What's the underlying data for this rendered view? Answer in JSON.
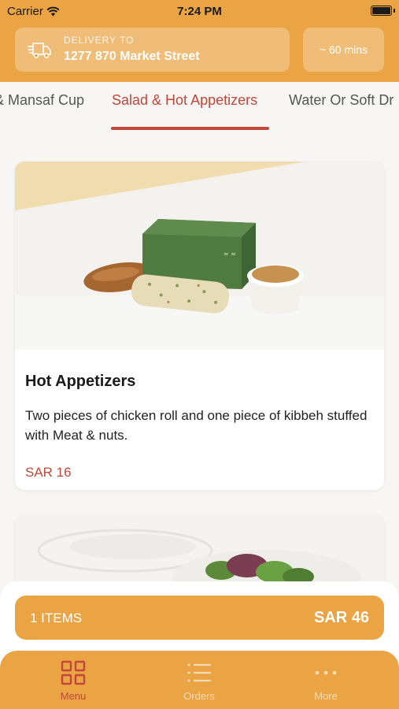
{
  "status_bar": {
    "carrier": "Carrier",
    "time": "7:24 PM"
  },
  "delivery": {
    "label": "DELIVERY TO",
    "address": "1277 870 Market Street",
    "eta": "~ 60 mins"
  },
  "tabs": [
    {
      "label": "& Mansaf Cup"
    },
    {
      "label": "Salad & Hot Appetizers",
      "active": true
    },
    {
      "label": "Water Or Soft Dr"
    }
  ],
  "products": [
    {
      "title": "Hot Appetizers",
      "description": "Two pieces of chicken roll and one  piece of kibbeh stuffed with Meat & nuts.",
      "price": "SAR 16"
    }
  ],
  "cart": {
    "items": "1 ITEMS",
    "total": "SAR 46"
  },
  "nav": [
    {
      "label": "Menu",
      "icon": "grid-icon",
      "active": true
    },
    {
      "label": "Orders",
      "icon": "list-icon"
    },
    {
      "label": "More",
      "icon": "more-icon"
    }
  ],
  "colors": {
    "brand": "#eba444",
    "accent": "#c0473a",
    "background": "#f7f6f5"
  }
}
